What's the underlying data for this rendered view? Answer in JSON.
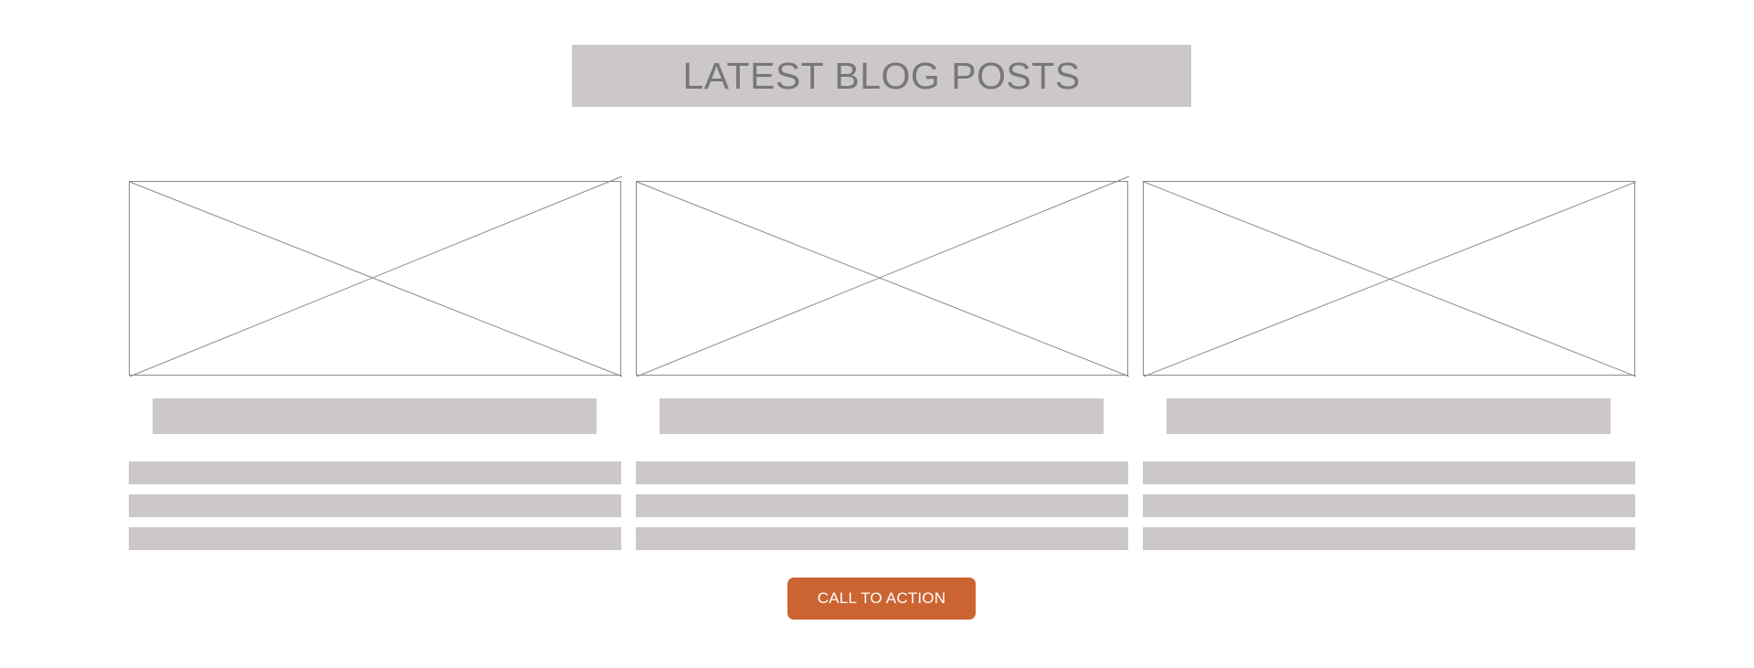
{
  "section": {
    "heading": "LATEST BLOG POSTS"
  },
  "cards": [
    {
      "image_placeholder": "image-placeholder"
    },
    {
      "image_placeholder": "image-placeholder"
    },
    {
      "image_placeholder": "image-placeholder"
    }
  ],
  "cta": {
    "label": "CALL TO ACTION"
  },
  "colors": {
    "placeholder_fill": "#cbc8c7",
    "heading_text": "#777777",
    "cta_background": "#cc6431",
    "cta_text": "#ffffff",
    "wire_stroke": "#8a8a8a"
  }
}
